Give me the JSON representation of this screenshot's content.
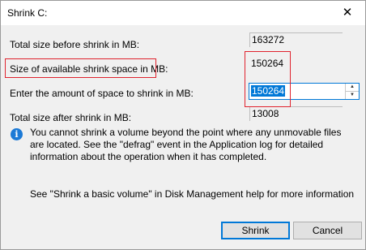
{
  "window": {
    "title": "Shrink C:",
    "close_glyph": "✕"
  },
  "fields": {
    "total_before_label": "Total size before shrink in MB:",
    "total_before_value": "163272",
    "available_label": "Size of available shrink space in MB:",
    "available_value": "150264",
    "amount_label": "Enter the amount of space to shrink in MB:",
    "amount_value": "150264",
    "total_after_label": "Total size after shrink in MB:",
    "total_after_value": "13008"
  },
  "info": {
    "icon": "info-icon",
    "text": "You cannot shrink a volume beyond the point where any unmovable files are located. See the \"defrag\" event in the Application log for detailed information about the operation when it has completed."
  },
  "help": {
    "text": "See \"Shrink a basic volume\" in Disk Management help for more information"
  },
  "buttons": {
    "shrink": "Shrink",
    "cancel": "Cancel"
  },
  "colors": {
    "highlight": "#e0232e",
    "accent": "#0078d7",
    "info": "#1c7ad6"
  }
}
